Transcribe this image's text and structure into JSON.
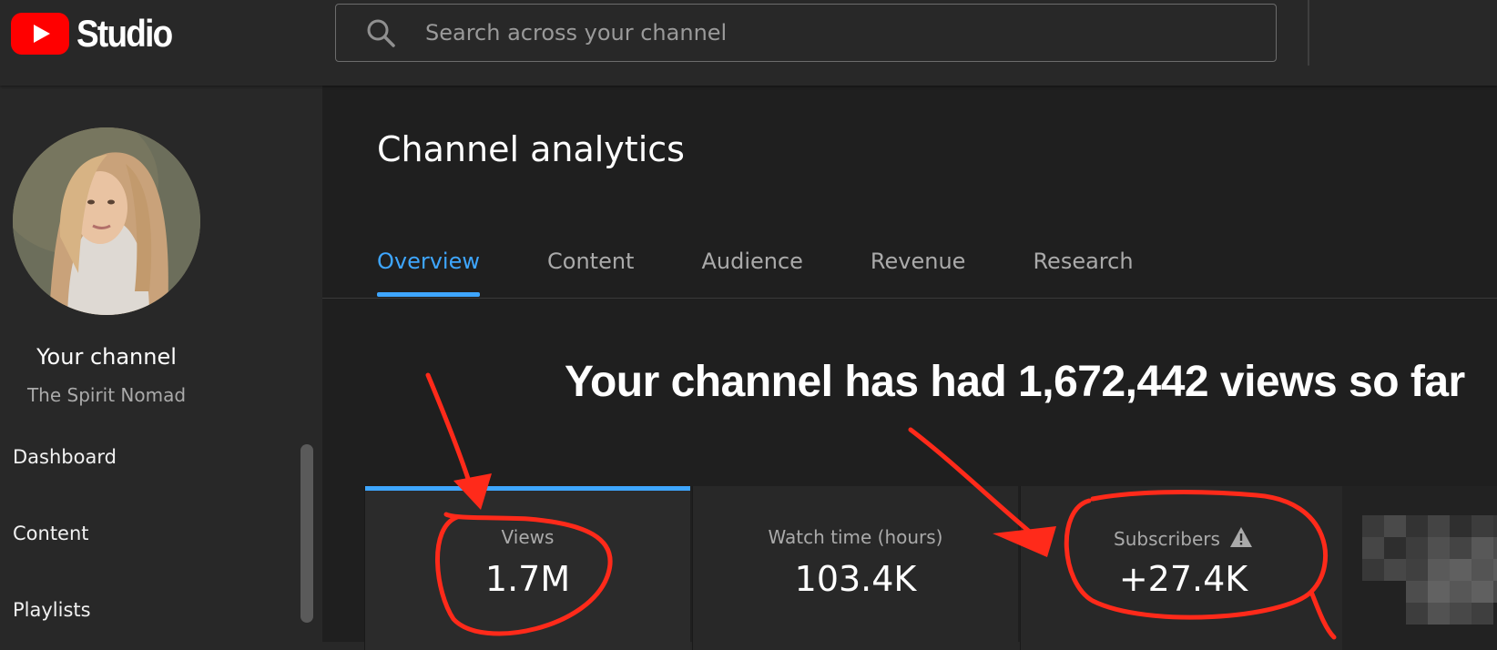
{
  "header": {
    "logo_text": "Studio",
    "search_placeholder": "Search across your channel"
  },
  "sidebar": {
    "channel_title": "Your channel",
    "channel_name": "The Spirit Nomad",
    "nav_items": [
      {
        "label": "Dashboard"
      },
      {
        "label": "Content"
      },
      {
        "label": "Playlists"
      }
    ]
  },
  "main": {
    "page_title": "Channel analytics",
    "tabs": [
      {
        "label": "Overview",
        "active": true
      },
      {
        "label": "Content"
      },
      {
        "label": "Audience"
      },
      {
        "label": "Revenue"
      },
      {
        "label": "Research"
      }
    ],
    "metrics": [
      {
        "label": "Views",
        "value": "1.7M"
      },
      {
        "label": "Watch time (hours)",
        "value": "103.4K"
      },
      {
        "label": "Subscribers",
        "value": "+27.4K",
        "icon": "warning-icon"
      }
    ]
  },
  "annotation": {
    "text": "Your channel has had 1,672,442 views so far",
    "color": "#ff2a1a"
  },
  "colors": {
    "accent": "#3ea6ff",
    "brand_red": "#ff0000",
    "background": "#1f1f1f",
    "panel": "#282828"
  }
}
